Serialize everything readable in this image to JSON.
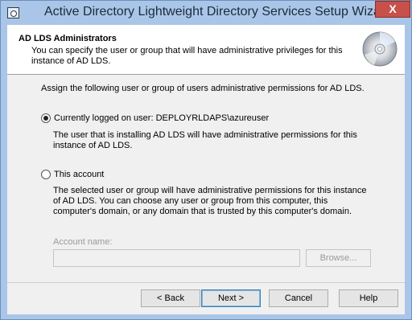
{
  "window": {
    "title": "Active Directory Lightweight Directory Services Setup Wizard",
    "close_glyph": "X"
  },
  "header": {
    "title": "AD LDS Administrators",
    "subtitle": "You can specify the user or group that will have administrative privileges for this instance of AD LDS."
  },
  "body": {
    "instruction": "Assign the following user or group of users administrative permissions for AD LDS.",
    "options": [
      {
        "label": "Currently logged on user: DEPLOYRLDAPS\\azureuser",
        "description": "The user that is installing AD LDS will have administrative permissions for this instance of AD LDS.",
        "selected": true
      },
      {
        "label": "This account",
        "description": "The selected user or group will have administrative permissions for this instance of AD LDS. You can choose any user or group from this computer, this computer's domain, or any domain that is trusted by this computer's domain.",
        "selected": false
      }
    ],
    "account_name_label": "Account name:",
    "account_name_value": "",
    "browse_label": "Browse..."
  },
  "footer": {
    "back_label": "< Back",
    "next_label": "Next >",
    "cancel_label": "Cancel",
    "help_label": "Help"
  }
}
